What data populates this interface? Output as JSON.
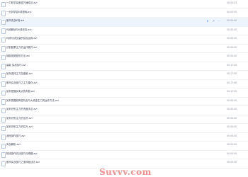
{
  "file_list": {
    "rows": [
      {
        "name": "一刀斩学赢股技巧速成法.avi",
        "duration": "00:00:03",
        "highlighted": false
      },
      {
        "name": "一分钟学会K线基础.avi",
        "duration": "00:00:00",
        "highlighted": false
      },
      {
        "name": "股市实战K线.avi",
        "duration": "00:00:00",
        "highlighted": true
      },
      {
        "name": "均线解读与K线形态.avi",
        "duration": "00:00:00",
        "highlighted": false
      },
      {
        "name": "均线与成交量的结合运用.avi",
        "duration": "00:00:00",
        "highlighted": false
      },
      {
        "name": "识别股票主力的运作模式.avi",
        "duration": "00:00:00",
        "highlighted": false
      },
      {
        "name": "捕捉强势股的方法.avi",
        "duration": "00:00:00",
        "highlighted": false
      },
      {
        "name": "量能 实战技巧.avi",
        "duration": "00:17:00",
        "highlighted": false
      },
      {
        "name": "如何选择主力控盘股.avi",
        "duration": "00:17:00",
        "highlighted": false
      },
      {
        "name": "股市实战技巧之主力建仓.avi",
        "duration": "00:17:00",
        "highlighted": false
      },
      {
        "name": "如何把握买卖点的判断.avi",
        "duration": "00:17:00",
        "highlighted": false
      },
      {
        "name": "如何把握趋势性机会与大资金主力的运作方法.avi",
        "duration": "00:00:00",
        "highlighted": false
      },
      {
        "name": "如何识别主力的洗盘手法.avi",
        "duration": "00:00:00",
        "highlighted": false
      },
      {
        "name": "如何识别主力的出货.avi",
        "duration": "00:00:00",
        "highlighted": false
      },
      {
        "name": "如何识别主力的拉升.avi",
        "duration": "00:00:00",
        "highlighted": false
      },
      {
        "name": "波段操作技巧.avi",
        "duration": "00:00:00",
        "highlighted": false
      },
      {
        "name": "实战解析.avi",
        "duration": "00:00:00",
        "highlighted": false
      },
      {
        "name": "短线操作实战技巧与精髓.avi",
        "duration": "00:00:00",
        "highlighted": false
      },
      {
        "name": "股市实战技巧之涨停板战法.avi",
        "duration": "00:00:00",
        "highlighted": false
      }
    ],
    "actions": {
      "download_icon": "download-icon",
      "share_icon": "share-icon",
      "more_icon": "more-icon",
      "download_glyph": "⬇",
      "share_glyph": "↗",
      "more_glyph": "⋯",
      "accent": "#4f8ef7"
    }
  },
  "watermark": "Suvvv.com"
}
